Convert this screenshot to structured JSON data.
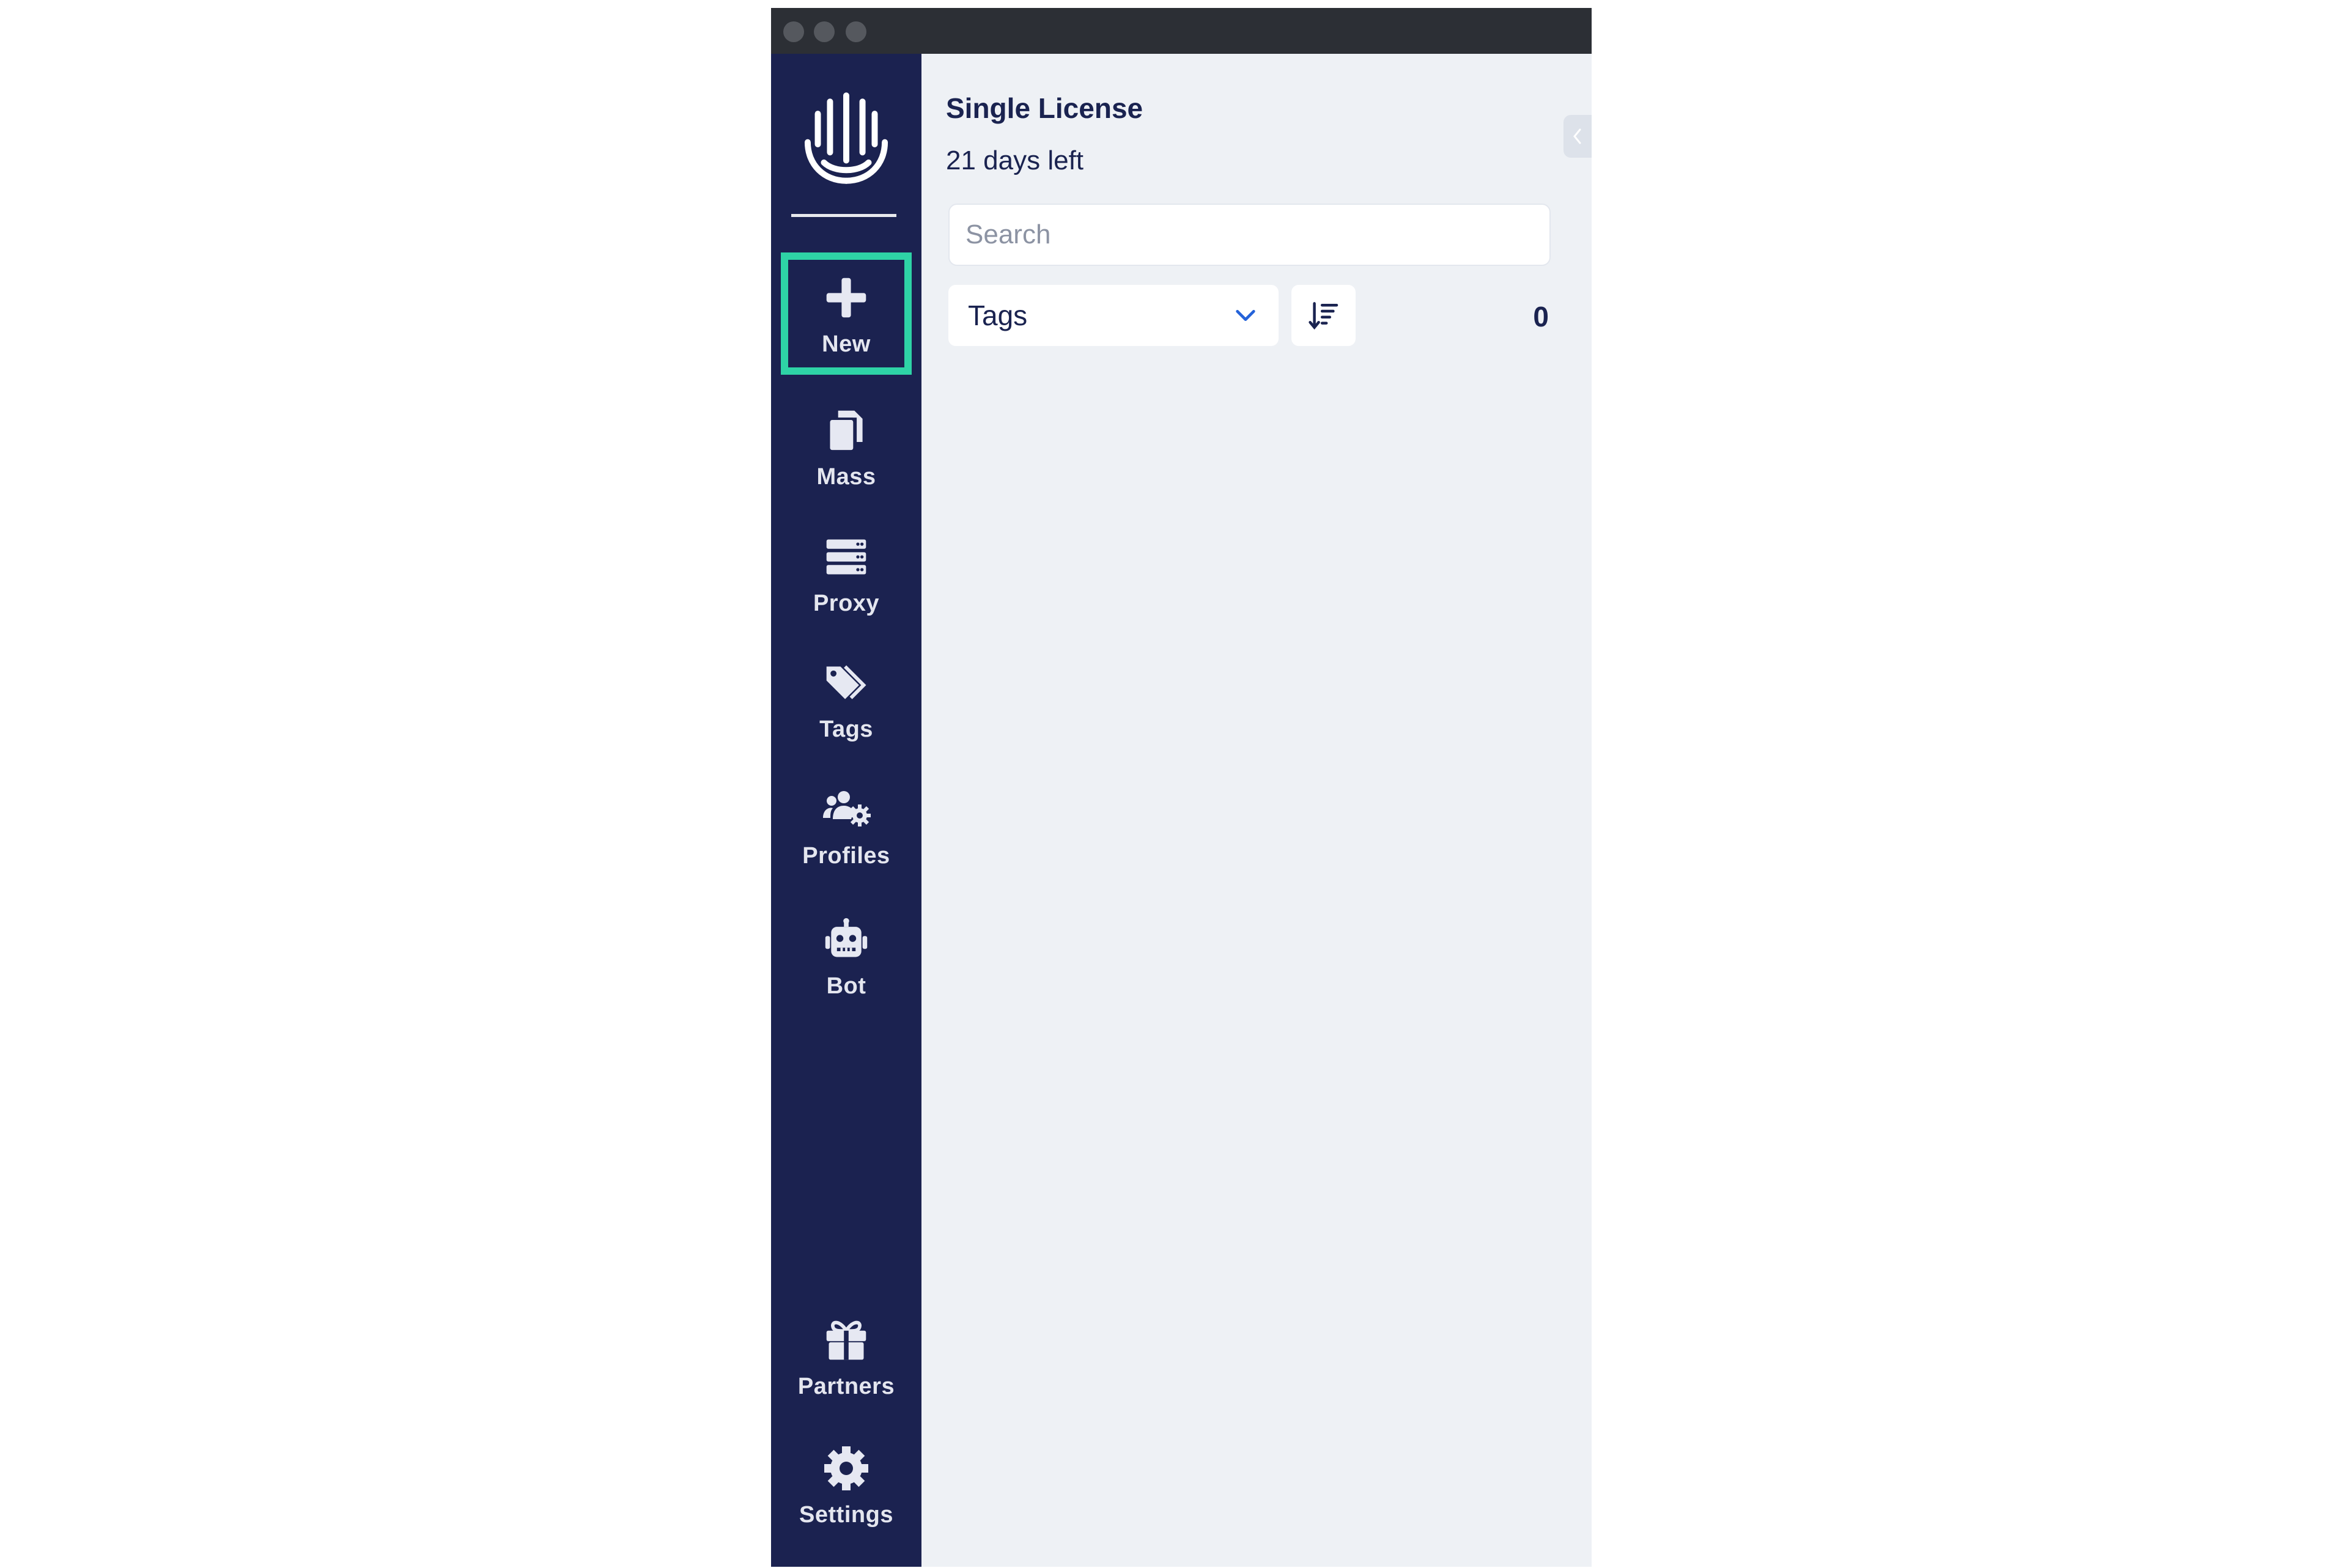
{
  "sidebar": {
    "items": [
      {
        "label": "New",
        "icon": "plus-icon"
      },
      {
        "label": "Mass",
        "icon": "copy-icon"
      },
      {
        "label": "Proxy",
        "icon": "server-icon"
      },
      {
        "label": "Tags",
        "icon": "tags-icon"
      },
      {
        "label": "Profiles",
        "icon": "users-gear-icon"
      },
      {
        "label": "Bot",
        "icon": "robot-icon"
      }
    ],
    "bottom_items": [
      {
        "label": "Partners",
        "icon": "gift-icon"
      },
      {
        "label": "Settings",
        "icon": "gear-icon"
      }
    ],
    "highlight_color": "#2ed3a6",
    "background_color": "#1b2250"
  },
  "license": {
    "title": "Single License",
    "days_left": "21 days left"
  },
  "search": {
    "placeholder": "Search",
    "value": ""
  },
  "filter": {
    "tags_label": "Tags",
    "count": "0"
  }
}
